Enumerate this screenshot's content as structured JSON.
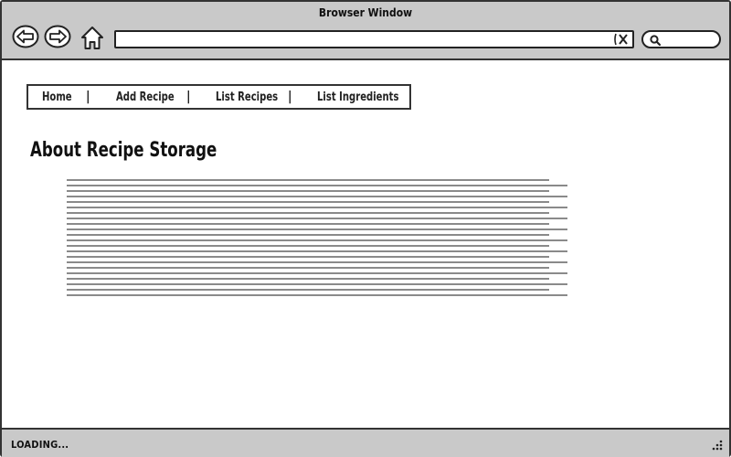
{
  "window": {
    "title": "Browser Window"
  },
  "toolbar": {
    "back_icon": "back-arrow-icon",
    "forward_icon": "forward-arrow-icon",
    "home_icon": "home-icon",
    "address_value": "",
    "clear_icon": "close-icon",
    "search_value": "",
    "search_icon": "search-icon"
  },
  "nav": {
    "items": [
      {
        "label": "Home"
      },
      {
        "label": "Add Recipe"
      },
      {
        "label": "List Recipes"
      },
      {
        "label": "List Ingredients"
      }
    ],
    "separator": "|"
  },
  "main": {
    "heading": "About Recipe Storage",
    "paragraph_placeholder": "text-lines"
  },
  "status": {
    "text": "LOADING..."
  },
  "colors": {
    "chrome_bg": "#c9c9c9",
    "border": "#333333",
    "text_line": "#8a8a8a",
    "page_bg": "#ffffff"
  }
}
